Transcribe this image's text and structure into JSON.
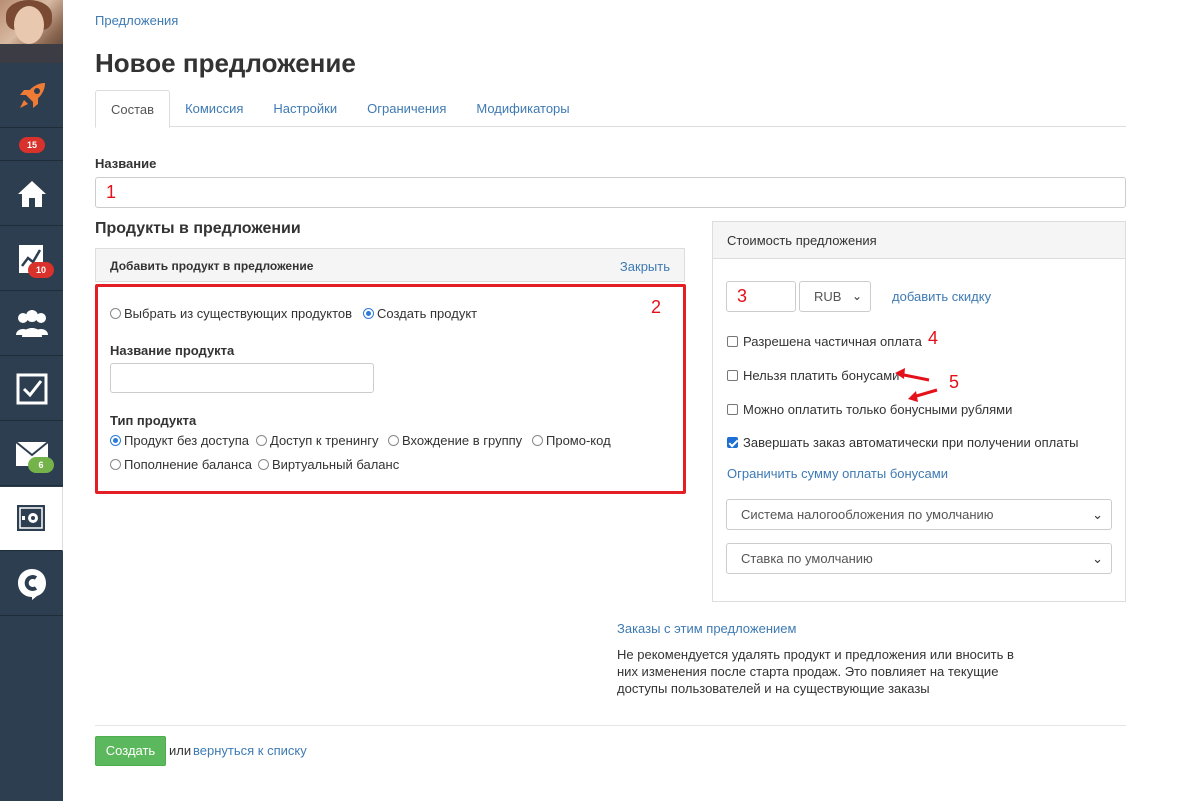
{
  "sidebar": {
    "badges": {
      "home": "15",
      "stats": "10",
      "mail": "6"
    }
  },
  "breadcrumb": "Предложения",
  "page_title": "Новое предложение",
  "tabs": [
    "Состав",
    "Комиссия",
    "Настройки",
    "Ограничения",
    "Модификаторы"
  ],
  "name_label": "Название",
  "name_value": "1",
  "products": {
    "section_title": "Продукты в предложении",
    "panel_title": "Добавить продукт в предложение",
    "close_label": "Закрыть",
    "annotation": "2",
    "source_options": [
      "Выбрать из существующих продуктов",
      "Создать продукт"
    ],
    "source_selected": 1,
    "product_name_label": "Название продукта",
    "product_name_value": "",
    "product_type_label": "Тип продукта",
    "type_options": [
      "Продукт без доступа",
      "Доступ к тренингу",
      "Вхождение в группу",
      "Промо-код",
      "Пополнение баланса",
      "Виртуальный баланс"
    ],
    "type_selected": 0
  },
  "price": {
    "header": "Стоимость предложения",
    "value": "3",
    "currency": "RUB",
    "add_discount": "добавить скидку",
    "checkboxes": [
      {
        "label": "Разрешена частичная оплата",
        "checked": false
      },
      {
        "label": "Нельзя платить бонусами",
        "checked": false
      },
      {
        "label": "Можно оплатить только бонусными рублями",
        "checked": false
      },
      {
        "label": "Завершать заказ автоматически при получении оплаты",
        "checked": true
      }
    ],
    "limit_bonus_link": "Ограничить сумму оплаты бонусами",
    "tax_system": "Система налогообложения по умолчанию",
    "tax_rate": "Ставка по умолчанию",
    "annotations": {
      "partial": "4",
      "bonus": "5"
    }
  },
  "orders_link": "Заказы с этим предложением",
  "warning": "Не рекомендуется удалять продукт и предложения или вносить в них изменения после старта продаж. Это повлияет на текущие доступы пользователей и на существующие заказы",
  "footer": {
    "create": "Создать",
    "or": "или",
    "back": "вернуться к списку"
  },
  "colors": {
    "sidebar": "#2c3e50",
    "link": "#3e7ab3",
    "annotation": "#e4111a",
    "create": "#5cb85c"
  }
}
